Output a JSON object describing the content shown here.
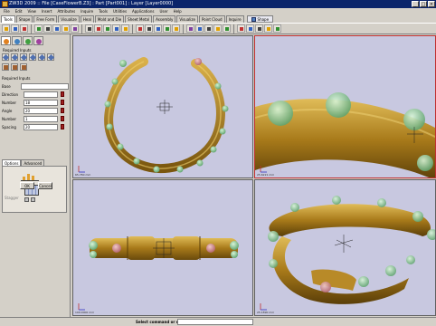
{
  "window": {
    "title": "ZW3D 2009 :: File [CaseFlowerB.Z3] : Part [Part001] : Layer [Layer0000]",
    "controls": [
      "_",
      "□",
      "×"
    ]
  },
  "menu": [
    "File",
    "Edit",
    "View",
    "Insert",
    "Attributes",
    "Inquire",
    "Tools",
    "Utilities",
    "Applications",
    "User",
    "Help"
  ],
  "tabs": [
    "Tools",
    "Shape",
    "Free Form",
    "Visualize",
    "Heal",
    "Mold and Die",
    "Sheet Metal",
    "Assembly",
    "Visualize",
    "Point Cloud",
    "Inquire"
  ],
  "ribbon": {
    "label": "Shape"
  },
  "left_panel": {
    "required_label": "Required Inputs",
    "required_inputs_label": "Required Inputs",
    "fields": [
      {
        "label": "Base",
        "value": ""
      },
      {
        "label": "Direction",
        "value": ""
      },
      {
        "label": "Number",
        "value": "18"
      },
      {
        "label": "Angle",
        "value": "20"
      },
      {
        "label": "Number",
        "value": "1"
      },
      {
        "label": "Spacing",
        "value": "20"
      }
    ],
    "option_tabs": [
      "Options",
      "Advanced"
    ],
    "disabled_label": "Stagger",
    "ok_label": "OK",
    "cancel_label": "Cancel"
  },
  "viewports": {
    "top_left": {
      "readout": "65.780 mm"
    },
    "top_right": {
      "readout": "25.6221 mm"
    },
    "bottom_left": {
      "readout": "100.0000 mm"
    },
    "bottom_right": {
      "readout": "25.1890 mm"
    }
  },
  "colors": {
    "bracelet_gold": "#a87a1a",
    "bracelet_highlight": "#d9b04a",
    "gem_green": "#7ec48a",
    "gem_pink": "#c87a80",
    "viewport_bg": "#c8c8e0",
    "active_border": "#c03030"
  },
  "status": {
    "prompt": "Select command or entity"
  }
}
